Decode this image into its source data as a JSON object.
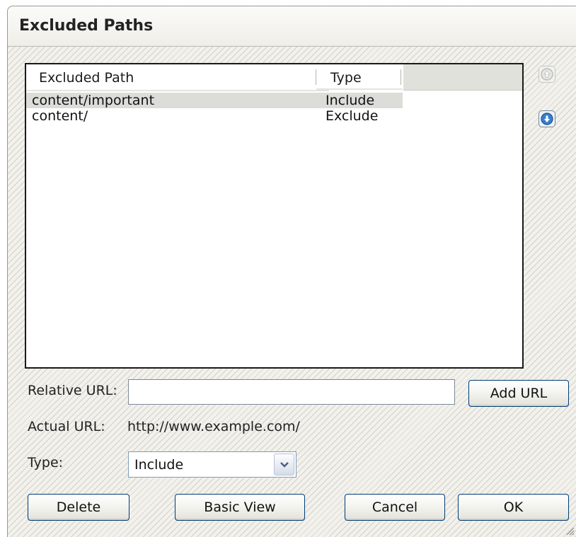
{
  "window": {
    "title": "Excluded Paths"
  },
  "table": {
    "columns": [
      "Excluded Path",
      "Type"
    ],
    "rows": [
      {
        "path": "content/important",
        "type": "Include",
        "selected": true
      },
      {
        "path": "content/",
        "type": "Exclude",
        "selected": false
      }
    ]
  },
  "icons": {
    "move_up": "arrow-up-circle-icon",
    "move_down": "arrow-down-circle-icon",
    "dropdown": "chevron-down-icon",
    "resize": "resize-grip-icon"
  },
  "form": {
    "relative_url_label": "Relative URL:",
    "relative_url_value": "",
    "add_url_label": "Add URL",
    "actual_url_label": "Actual URL:",
    "actual_url_value": "http://www.example.com/",
    "type_label": "Type:",
    "type_value": "Include"
  },
  "buttons": {
    "delete": "Delete",
    "basic_view": "Basic View",
    "cancel": "Cancel",
    "ok": "OK"
  },
  "colors": {
    "accent": "#3a7fd0",
    "selection": "#dcdcd8",
    "button_border": "#003c74"
  }
}
